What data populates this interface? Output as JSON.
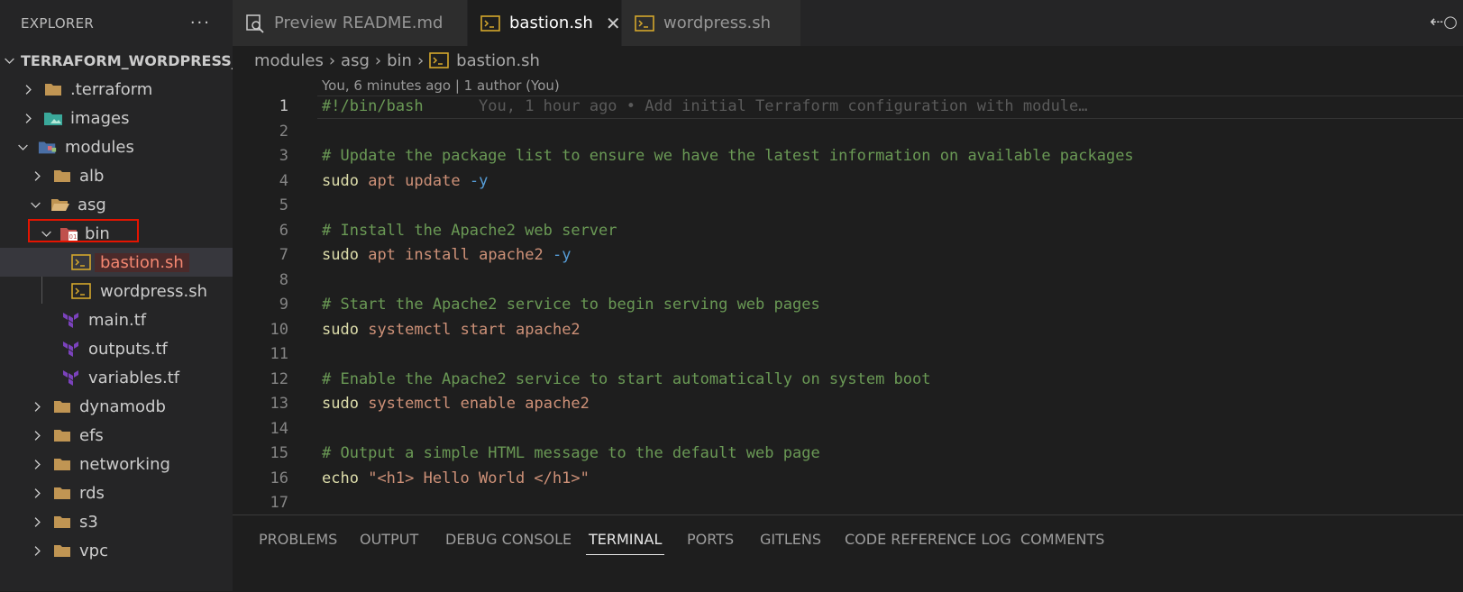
{
  "sidebar": {
    "title": "EXPLORER",
    "more": "···",
    "root": "TERRAFORM_WORDPRESS_A...",
    "items": [
      {
        "label": ".terraform"
      },
      {
        "label": "images"
      },
      {
        "label": "modules"
      },
      {
        "label": "alb"
      },
      {
        "label": "asg"
      },
      {
        "label": "bin"
      },
      {
        "label": "bastion.sh"
      },
      {
        "label": "wordpress.sh"
      },
      {
        "label": "main.tf"
      },
      {
        "label": "outputs.tf"
      },
      {
        "label": "variables.tf"
      },
      {
        "label": "dynamodb"
      },
      {
        "label": "efs"
      },
      {
        "label": "networking"
      },
      {
        "label": "rds"
      },
      {
        "label": "s3"
      },
      {
        "label": "vpc"
      }
    ]
  },
  "tabs": [
    {
      "label": "Preview README.md"
    },
    {
      "label": "bastion.sh"
    },
    {
      "label": "wordpress.sh"
    }
  ],
  "breadcrumb": [
    "modules",
    "asg",
    "bin",
    "bastion.sh"
  ],
  "editor": {
    "codelens": "You, 6 minutes ago | 1 author (You)",
    "blame": "You, 1 hour ago • Add initial Terraform configuration with module…",
    "line_numbers": [
      "1",
      "2",
      "3",
      "4",
      "5",
      "6",
      "7",
      "8",
      "9",
      "10",
      "11",
      "12",
      "13",
      "14",
      "15",
      "16",
      "17"
    ],
    "lines": {
      "l1": "#!/bin/bash",
      "l3": "# Update the package list to ensure we have the latest information on available packages",
      "l4": {
        "a": "sudo",
        "b": "apt",
        "c": "update",
        "d": "-y"
      },
      "l6": "# Install the Apache2 web server",
      "l7": {
        "a": "sudo",
        "b": "apt",
        "c": "install",
        "d": "apache2",
        "e": "-y"
      },
      "l9": "# Start the Apache2 service to begin serving web pages",
      "l10": {
        "a": "sudo",
        "b": "systemctl",
        "c": "start",
        "d": "apache2"
      },
      "l12": "# Enable the Apache2 service to start automatically on system boot",
      "l13": {
        "a": "sudo",
        "b": "systemctl",
        "c": "enable",
        "d": "apache2"
      },
      "l15": "# Output a simple HTML message to the default web page",
      "l16": {
        "a": "echo",
        "b": "\"<h1> Hello World </h1>\""
      }
    }
  },
  "panel": {
    "tabs": [
      "PROBLEMS",
      "OUTPUT",
      "DEBUG CONSOLE",
      "TERMINAL",
      "PORTS",
      "GITLENS",
      "CODE REFERENCE LOG",
      "COMMENTS"
    ],
    "active": "TERMINAL"
  }
}
